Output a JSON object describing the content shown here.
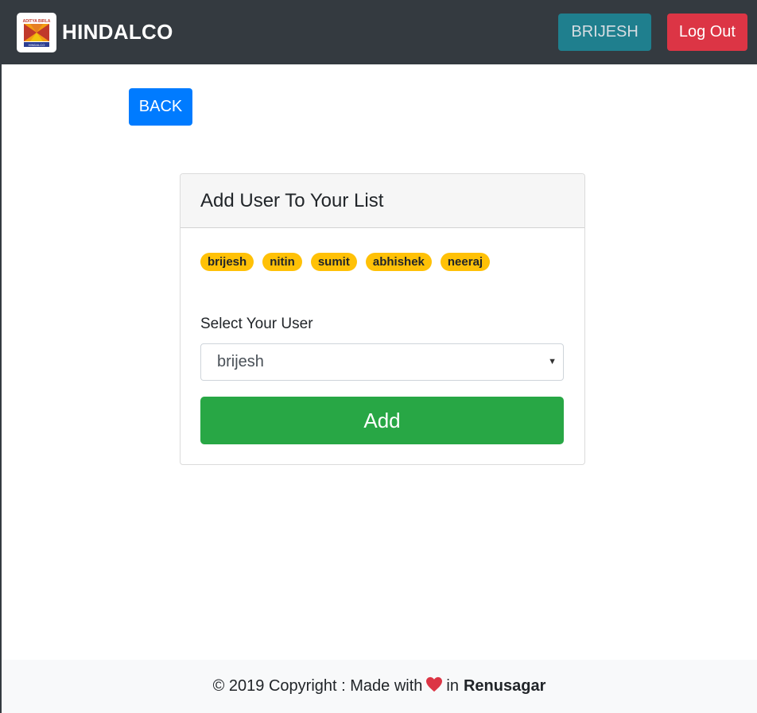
{
  "navbar": {
    "brand": "HINDALCO",
    "logo_text_top": "ADITYA BIRLA",
    "logo_text_bottom": "HINDALCO",
    "user_button": "BRIJESH",
    "logout_button": "Log Out"
  },
  "back_button": "BACK",
  "card": {
    "title": "Add User To Your List",
    "badges": [
      "brijesh",
      "nitin",
      "sumit",
      "abhishek",
      "neeraj"
    ],
    "select_label": "Select Your User",
    "selected_user": "brijesh",
    "add_button": "Add"
  },
  "footer": {
    "prefix": "© 2019 Copyright : Made with",
    "in_text": "in",
    "place": "Renusagar",
    "heart_icon": "heart-icon",
    "heart_color": "#dc3545"
  },
  "colors": {
    "navbar": "#343a40",
    "primary": "#007bff",
    "info": "#1f7f8e",
    "danger": "#dc3545",
    "success": "#28a745",
    "warning": "#ffc107"
  }
}
